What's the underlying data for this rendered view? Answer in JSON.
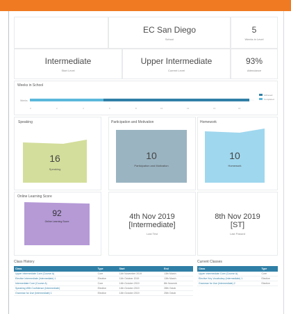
{
  "colors": {
    "accent": "#f07a22",
    "blue": "#2f7fa6",
    "light_blue": "#5bb8dc",
    "speaking": "#d4de9c",
    "participation": "#9bb4c2",
    "homework": "#9fd7ee",
    "online": "#b59ad6"
  },
  "stats": {
    "school": {
      "value": "EC San Diego",
      "label": "School"
    },
    "weeks": {
      "value": "5",
      "label": "Weeks in Level"
    },
    "start_level": {
      "value": "Intermediate",
      "label": "Start Level"
    },
    "current_level": {
      "value": "Upper Intermediate",
      "label": "Current Level"
    },
    "attendance": {
      "value": "93%",
      "label": "Attendance"
    }
  },
  "weeks_section": {
    "title": "Weeks in School",
    "row_label": "Weeks",
    "legend": [
      "Achieved",
      "Completed"
    ]
  },
  "speaking": {
    "title": "Speaking",
    "value": "16",
    "label": "Speaking"
  },
  "participation": {
    "title": "Participation and Motivation",
    "value": "10",
    "label": "Participation and Motivation"
  },
  "homework": {
    "title": "Homework",
    "value": "10",
    "label": "Homework"
  },
  "online": {
    "title": "Online Learning Score",
    "value": "92",
    "label": "Online Learning Score"
  },
  "last_test": {
    "date": "4th Nov 2019",
    "detail": "[Intermediate]",
    "label": "Last Test"
  },
  "last_passed": {
    "date": "8th Nov 2019",
    "detail": "[ST]",
    "label": "Last Passed"
  },
  "class_history": {
    "title": "Class History",
    "headers": [
      "Class",
      "Type",
      "Start",
      "End"
    ],
    "rows": [
      [
        "Upper Intermediate Core (Course A)",
        "Core",
        "11th November 2019",
        "13th March"
      ],
      [
        "Elective Intermediate (Intermediate) 1",
        "Elective",
        "11th October 2019",
        "13th March"
      ],
      [
        "Intermediate Core (Course A)",
        "Core",
        "14th October 2019",
        "8th Novemb"
      ],
      [
        "Speaking With Confidence (Intermediate)",
        "Elective",
        "14th October 2019",
        "28th Octob"
      ],
      [
        "Grammar for Use (Intermediate) 1",
        "Elective",
        "14th October 2019",
        "25th Octob"
      ]
    ]
  },
  "current_classes": {
    "title": "Current Classes",
    "headers": [
      "Class",
      "Type"
    ],
    "rows": [
      [
        "Upper Intermediate Core (Course A)",
        "Core"
      ],
      [
        "Elective Key Vocabulary (Intermediate) 1",
        "Elective"
      ],
      [
        "Grammar for Use (Intermediate) 2",
        "Elective"
      ]
    ]
  }
}
